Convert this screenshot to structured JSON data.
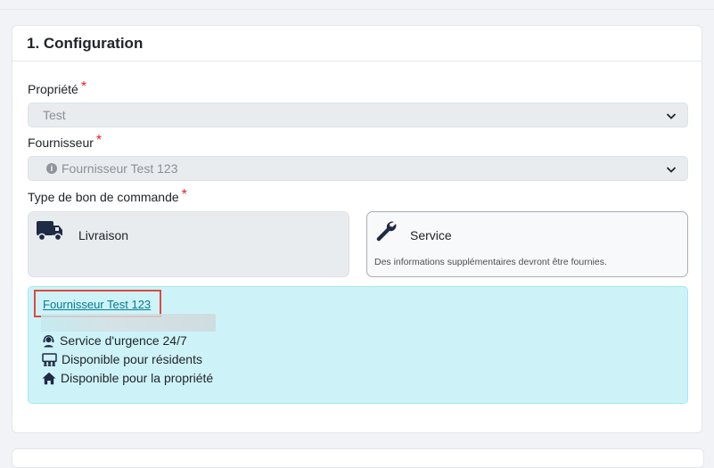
{
  "section": {
    "title": "1. Configuration"
  },
  "property": {
    "label": "Propriété",
    "required": "*",
    "value": "Test"
  },
  "supplier": {
    "label": "Fournisseur",
    "required": "*",
    "value": "Fournisseur Test 123"
  },
  "order_type": {
    "label": "Type de bon de commande",
    "required": "*",
    "options": [
      {
        "label": "Livraison",
        "icon": "truck-icon"
      },
      {
        "label": "Service",
        "icon": "wrench-icon",
        "description": "Des informations supplémentaires devront être fournies."
      }
    ]
  },
  "supplier_info": {
    "link": "Fournisseur Test 123",
    "features": [
      {
        "label": "Service d'urgence 24/7",
        "icon": "headset-icon"
      },
      {
        "label": "Disponible pour résidents",
        "icon": "people-icon"
      },
      {
        "label": "Disponible pour la propriété",
        "icon": "house-icon"
      }
    ]
  },
  "colors": {
    "accent": "#087990",
    "required": "#e02424",
    "info_bg": "#cdf3f8",
    "highlight": "#e0483e"
  }
}
